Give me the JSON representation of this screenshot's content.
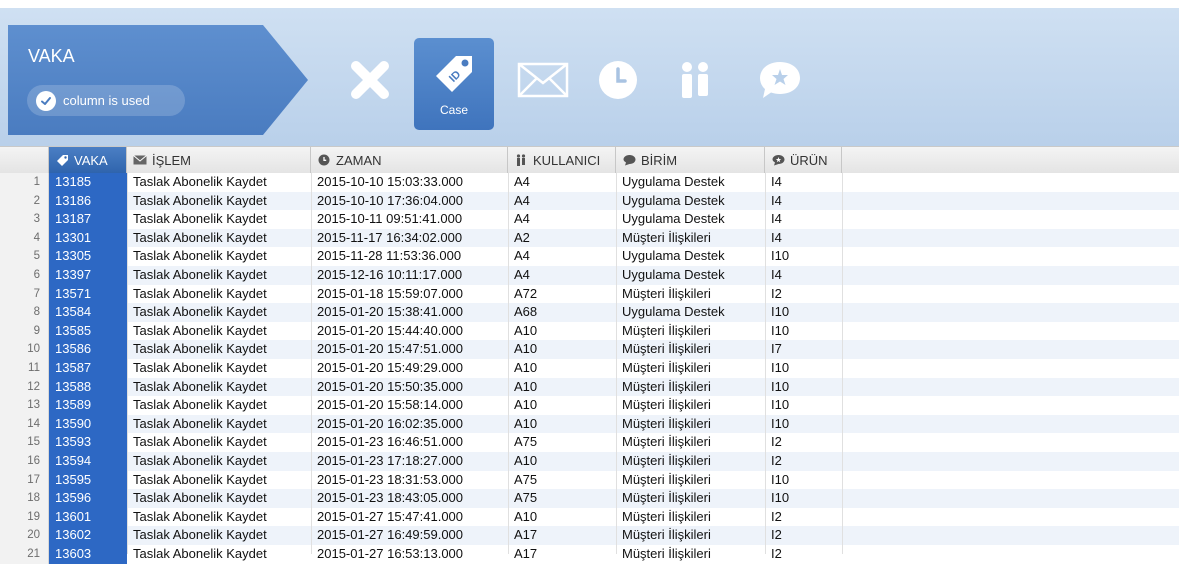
{
  "toolbar": {
    "title": "VAKA",
    "column_status": "column is used",
    "selected_label": "Case",
    "icons": [
      "close-icon",
      "tag-icon",
      "mail-icon",
      "clock-icon",
      "people-icon",
      "chat-star-icon"
    ]
  },
  "grid": {
    "headers": [
      "VAKA",
      "İŞLEM",
      "ZAMAN",
      "KULLANICI",
      "BİRİM",
      "ÜRÜN"
    ],
    "rows": [
      {
        "n": "1",
        "vaka": "13185",
        "islem": "Taslak Abonelik Kaydet",
        "zaman": "2015-10-10 15:03:33.000",
        "kul": "A4",
        "birim": "Uygulama Destek",
        "urun": "I4"
      },
      {
        "n": "2",
        "vaka": "13186",
        "islem": "Taslak Abonelik Kaydet",
        "zaman": "2015-10-10 17:36:04.000",
        "kul": "A4",
        "birim": "Uygulama Destek",
        "urun": "I4"
      },
      {
        "n": "3",
        "vaka": "13187",
        "islem": "Taslak Abonelik Kaydet",
        "zaman": "2015-10-11 09:51:41.000",
        "kul": "A4",
        "birim": "Uygulama Destek",
        "urun": "I4"
      },
      {
        "n": "4",
        "vaka": "13301",
        "islem": "Taslak Abonelik Kaydet",
        "zaman": "2015-11-17 16:34:02.000",
        "kul": "A2",
        "birim": "Müşteri İlişkileri",
        "urun": "I4"
      },
      {
        "n": "5",
        "vaka": "13305",
        "islem": "Taslak Abonelik Kaydet",
        "zaman": "2015-11-28 11:53:36.000",
        "kul": "A4",
        "birim": "Uygulama Destek",
        "urun": "I10"
      },
      {
        "n": "6",
        "vaka": "13397",
        "islem": "Taslak Abonelik Kaydet",
        "zaman": "2015-12-16 10:11:17.000",
        "kul": "A4",
        "birim": "Uygulama Destek",
        "urun": "I4"
      },
      {
        "n": "7",
        "vaka": "13571",
        "islem": "Taslak Abonelik Kaydet",
        "zaman": "2015-01-18 15:59:07.000",
        "kul": "A72",
        "birim": "Müşteri İlişkileri",
        "urun": "I2"
      },
      {
        "n": "8",
        "vaka": "13584",
        "islem": "Taslak Abonelik Kaydet",
        "zaman": "2015-01-20 15:38:41.000",
        "kul": "A68",
        "birim": "Uygulama Destek",
        "urun": "I10"
      },
      {
        "n": "9",
        "vaka": "13585",
        "islem": "Taslak Abonelik Kaydet",
        "zaman": "2015-01-20 15:44:40.000",
        "kul": "A10",
        "birim": "Müşteri İlişkileri",
        "urun": "I10"
      },
      {
        "n": "10",
        "vaka": "13586",
        "islem": "Taslak Abonelik Kaydet",
        "zaman": "2015-01-20 15:47:51.000",
        "kul": "A10",
        "birim": "Müşteri İlişkileri",
        "urun": "I7"
      },
      {
        "n": "11",
        "vaka": "13587",
        "islem": "Taslak Abonelik Kaydet",
        "zaman": "2015-01-20 15:49:29.000",
        "kul": "A10",
        "birim": "Müşteri İlişkileri",
        "urun": "I10"
      },
      {
        "n": "12",
        "vaka": "13588",
        "islem": "Taslak Abonelik Kaydet",
        "zaman": "2015-01-20 15:50:35.000",
        "kul": "A10",
        "birim": "Müşteri İlişkileri",
        "urun": "I10"
      },
      {
        "n": "13",
        "vaka": "13589",
        "islem": "Taslak Abonelik Kaydet",
        "zaman": "2015-01-20 15:58:14.000",
        "kul": "A10",
        "birim": "Müşteri İlişkileri",
        "urun": "I10"
      },
      {
        "n": "14",
        "vaka": "13590",
        "islem": "Taslak Abonelik Kaydet",
        "zaman": "2015-01-20 16:02:35.000",
        "kul": "A10",
        "birim": "Müşteri İlişkileri",
        "urun": "I10"
      },
      {
        "n": "15",
        "vaka": "13593",
        "islem": "Taslak Abonelik Kaydet",
        "zaman": "2015-01-23 16:46:51.000",
        "kul": "A75",
        "birim": "Müşteri İlişkileri",
        "urun": "I2"
      },
      {
        "n": "16",
        "vaka": "13594",
        "islem": "Taslak Abonelik Kaydet",
        "zaman": "2015-01-23 17:18:27.000",
        "kul": "A10",
        "birim": "Müşteri İlişkileri",
        "urun": "I2"
      },
      {
        "n": "17",
        "vaka": "13595",
        "islem": "Taslak Abonelik Kaydet",
        "zaman": "2015-01-23 18:31:53.000",
        "kul": "A75",
        "birim": "Müşteri İlişkileri",
        "urun": "I10"
      },
      {
        "n": "18",
        "vaka": "13596",
        "islem": "Taslak Abonelik Kaydet",
        "zaman": "2015-01-23 18:43:05.000",
        "kul": "A75",
        "birim": "Müşteri İlişkileri",
        "urun": "I10"
      },
      {
        "n": "19",
        "vaka": "13601",
        "islem": "Taslak Abonelik Kaydet",
        "zaman": "2015-01-27 15:47:41.000",
        "kul": "A10",
        "birim": "Müşteri İlişkileri",
        "urun": "I2"
      },
      {
        "n": "20",
        "vaka": "13602",
        "islem": "Taslak Abonelik Kaydet",
        "zaman": "2015-01-27 16:49:59.000",
        "kul": "A17",
        "birim": "Müşteri İlişkileri",
        "urun": "I2"
      },
      {
        "n": "21",
        "vaka": "13603",
        "islem": "Taslak Abonelik Kaydet",
        "zaman": "2015-01-27 16:53:13.000",
        "kul": "A17",
        "birim": "Müşteri İlişkileri",
        "urun": "I2"
      }
    ]
  }
}
